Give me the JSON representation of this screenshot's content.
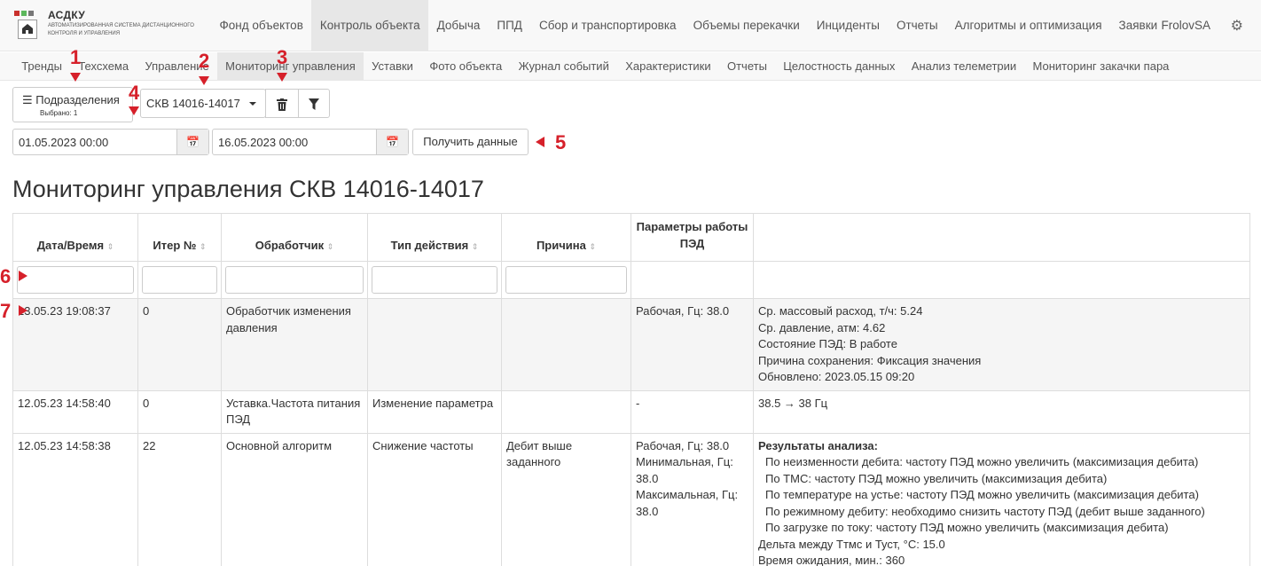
{
  "app": {
    "title": "АСДКУ",
    "subtitle": "Автоматизированная система дистанционного контроля и управления",
    "user": "FrolovSA"
  },
  "nav": [
    "Фонд объектов",
    "Контроль объекта",
    "Добыча",
    "ППД",
    "Сбор и транспортировка",
    "Объемы перекачки",
    "Инциденты",
    "Отчеты",
    "Алгоритмы и оптимизация",
    "Заявки"
  ],
  "nav_active": "Контроль объекта",
  "subnav": [
    "Тренды",
    "Техсхема",
    "Управление",
    "Мониторинг управления",
    "Уставки",
    "Фото объекта",
    "Журнал событий",
    "Характеристики",
    "Отчеты",
    "Целостность данных",
    "Анализ телеметрии",
    "Мониторинг закачки пара"
  ],
  "subnav_active": "Мониторинг управления",
  "toolbar": {
    "subdivisions_label": "Подразделения",
    "subdivisions_selected": "Выбрано: 1",
    "well_select": "СКВ 14016-14017",
    "date_from": "01.05.2023 00:00",
    "date_to": "16.05.2023 00:00",
    "get_data_label": "Получить данные"
  },
  "page_title": "Мониторинг управления СКВ 14016-14017",
  "table": {
    "headers": [
      "Дата/Время",
      "Итер №",
      "Обработчик",
      "Тип действия",
      "Причина",
      "Параметры работы ПЭД",
      ""
    ],
    "rows": [
      {
        "datetime": "13.05.23 19:08:37",
        "iter": "0",
        "handler": "Обработчик изменения давления",
        "action": "",
        "reason": "",
        "params": "Рабочая, Гц: 38.0",
        "details": [
          "Ср. массовый расход, т/ч: 5.24",
          "Ср. давление, атм: 4.62",
          "Состояние ПЭД: В работе",
          "Причина сохранения: Фиксация значения",
          "Обновлено: 2023.05.15 09:20"
        ]
      },
      {
        "datetime": "12.05.23 14:58:40",
        "iter": "0",
        "handler": "Уставка.Частота питания ПЭД",
        "action": "Изменение параметра",
        "reason": "",
        "params": "-",
        "details": [
          "38.5 → 38 Гц"
        ]
      },
      {
        "datetime": "12.05.23 14:58:38",
        "iter": "22",
        "handler": "Основной алгоритм",
        "action": "Снижение частоты",
        "reason": "Дебит выше заданного",
        "params_lines": [
          "Рабочая, Гц: 38.0",
          "Минимальная, Гц: 38.0",
          "Максимальная, Гц: 38.0"
        ],
        "details_head": "Результаты анализа:",
        "details_items": [
          "По неизменности дебита: частоту ПЭД можно увеличить (максимизация дебита)",
          "По ТМС: частоту ПЭД можно увеличить (максимизация дебита)",
          "По температуре на устье: частоту ПЭД можно увеличить (максимизация дебита)",
          "По режимному дебиту: необходимо снизить частоту ПЭД (дебит выше заданного)",
          "По загрузке по току: частоту ПЭД можно увеличить (максимизация дебита)"
        ],
        "details_tail": [
          "Дельта между Ттмс и Туст, °С: 15.0",
          "Время ожидания, мин.: 360"
        ]
      }
    ]
  },
  "annotations": [
    "1",
    "2",
    "3",
    "4",
    "5",
    "6",
    "7"
  ],
  "colors": {
    "annotation": "#d6202a",
    "nav_active_bg": "#e7e7e7"
  }
}
